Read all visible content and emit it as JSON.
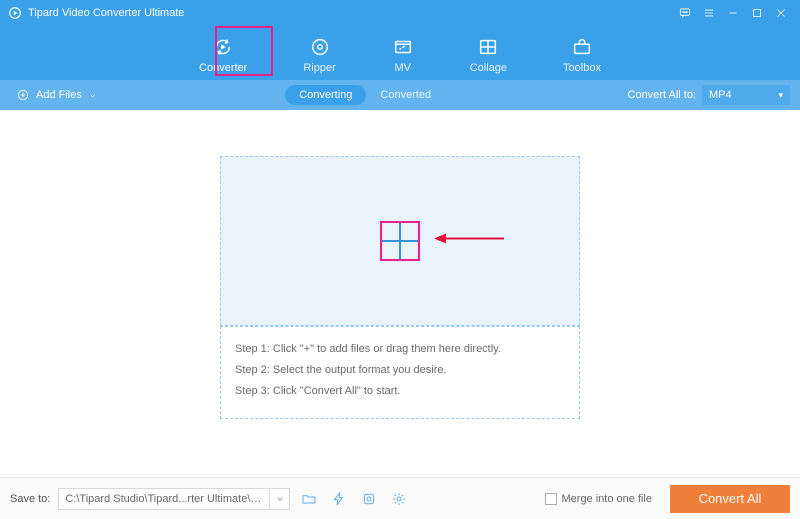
{
  "app": {
    "title": "Tipard Video Converter Ultimate"
  },
  "tabs": {
    "converter": "Converter",
    "ripper": "Ripper",
    "mv": "MV",
    "collage": "Collage",
    "toolbox": "Toolbox"
  },
  "toolbar": {
    "add_files": "Add Files",
    "converting": "Converting",
    "converted": "Converted",
    "convert_all_to": "Convert All to:",
    "format": "MP4"
  },
  "steps": {
    "s1": "Step 1: Click \"+\" to add files or drag them here directly.",
    "s2": "Step 2: Select the output format you desire.",
    "s3": "Step 3: Click \"Convert All\" to start."
  },
  "footer": {
    "save_to_label": "Save to:",
    "path": "C:\\Tipard Studio\\Tipard...rter Ultimate\\Converted",
    "merge": "Merge into one file",
    "convert_all": "Convert All"
  }
}
